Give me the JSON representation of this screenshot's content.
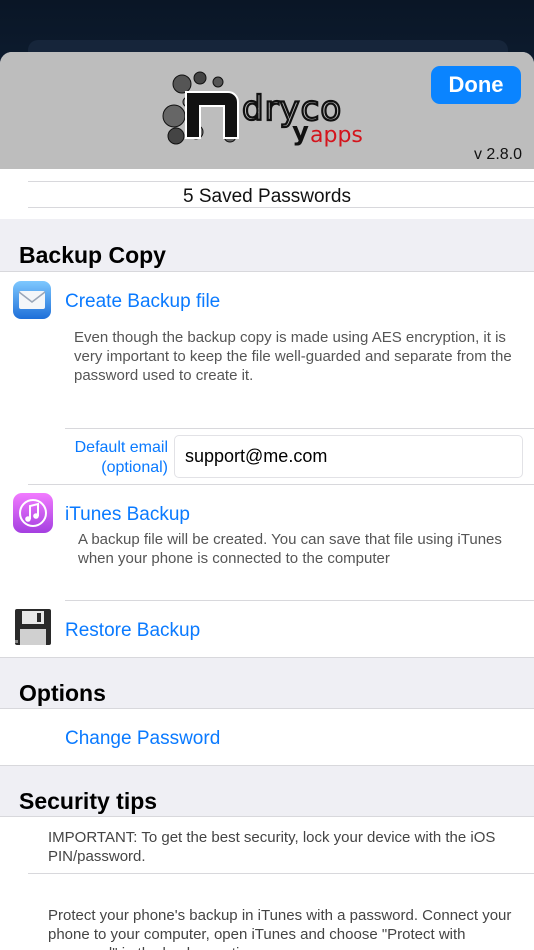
{
  "header": {
    "done_label": "Done",
    "version": "v 2.8.0",
    "logo_text_top": "ndryco",
    "logo_text_bottom": "apps"
  },
  "saved_passwords": "5 Saved Passwords",
  "backup_copy": {
    "title": "Backup Copy",
    "create_backup": {
      "label": "Create Backup file",
      "description": "Even though the backup copy is made using AES encryption, it is very important to keep the file well-guarded and separate from the password used to create it.",
      "icon": "mail-icon"
    },
    "default_email": {
      "label_line1": "Default email",
      "label_line2": "(optional)",
      "value": "support@me.com"
    },
    "itunes_backup": {
      "label": "iTunes Backup",
      "description": "A backup file will be created. You can save that file using iTunes when your phone is connected to the computer",
      "icon": "itunes-icon"
    },
    "restore_backup": {
      "label": "Restore Backup",
      "icon": "floppy-disk-icon"
    }
  },
  "options": {
    "title": "Options",
    "change_password": "Change Password"
  },
  "security_tips": {
    "title": "Security tips",
    "tip1": "IMPORTANT: To get the best security, lock your device with the iOS PIN/password.",
    "tip2": "Protect your phone's backup in iTunes with a password. Connect your phone to your computer, open iTunes and choose \"Protect with password\" in the backup options"
  },
  "colors": {
    "accent": "#0a7aff",
    "done_button": "#0a84ff",
    "header_bg": "#bdbdbd",
    "page_bg": "#efeff4"
  }
}
